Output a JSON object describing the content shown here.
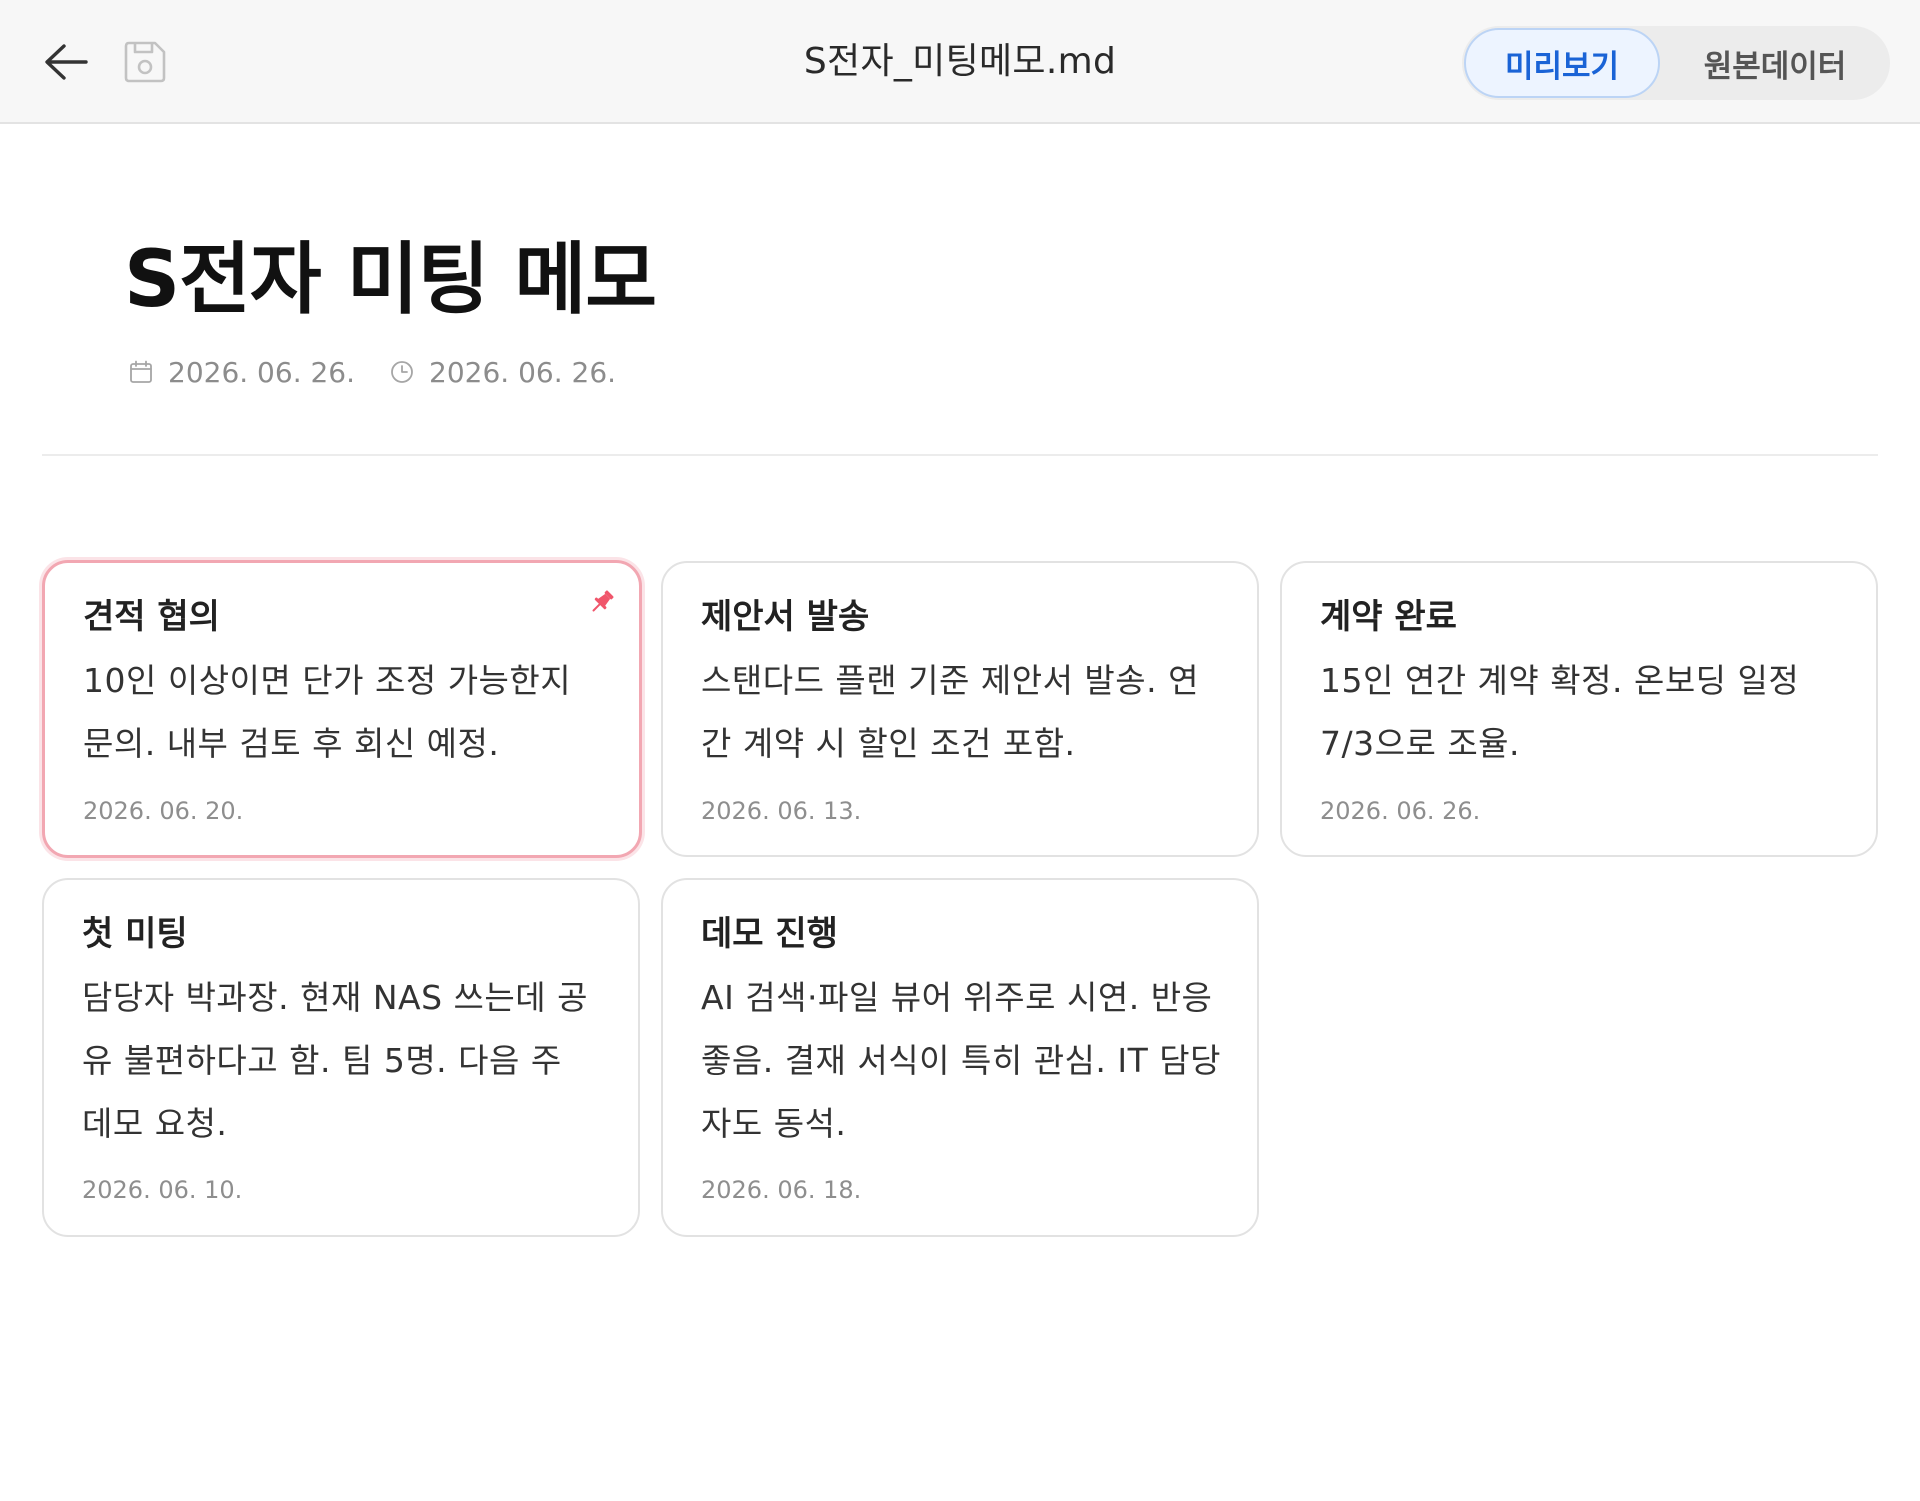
{
  "toolbar": {
    "back_icon": "arrow-left-icon",
    "save_icon": "save-disk-icon",
    "file_name": "S전자_미팅메모.md",
    "view_toggle": {
      "preview_label": "미리보기",
      "raw_label": "원본데이터",
      "selected": "미리보기"
    }
  },
  "document": {
    "title": "S전자 미팅 메모",
    "created_icon": "calendar-icon",
    "created": "2026. 06. 26.",
    "modified_icon": "clock-icon",
    "modified": "2026. 06. 26."
  },
  "cards": [
    {
      "title": "견적 협의",
      "body": "10인 이상이면 단가 조정 가능한지 문의. 내부 검토 후 회신 예정.",
      "date": "2026. 06. 20.",
      "pinned": true,
      "pin_icon": "pin-icon"
    },
    {
      "title": "제안서 발송",
      "body": "스탠다드 플랜 기준 제안서 발송. 연간 계약 시 할인 조건 포함.",
      "date": "2026. 06. 13.",
      "pinned": false
    },
    {
      "title": "계약 완료",
      "body": "15인 연간 계약 확정. 온보딩 일정 7/3으로 조율.",
      "date": "2026. 06. 26.",
      "pinned": false
    },
    {
      "title": "첫 미팅",
      "body": "담당자 박과장. 현재 NAS 쓰는데 공유 불편하다고 함. 팀 5명. 다음 주 데모 요청.",
      "date": "2026. 06. 10.",
      "pinned": false
    },
    {
      "title": "데모 진행",
      "body": "AI 검색·파일 뷰어 위주로 시연. 반응 좋음. 결재 서식이 특히 관심. IT 담당자도 동석.",
      "date": "2026. 06. 18.",
      "pinned": false
    }
  ],
  "colors": {
    "accent": "#1a63d6",
    "pin": "#f0566b",
    "pinned_border": "#f2a7b2"
  }
}
